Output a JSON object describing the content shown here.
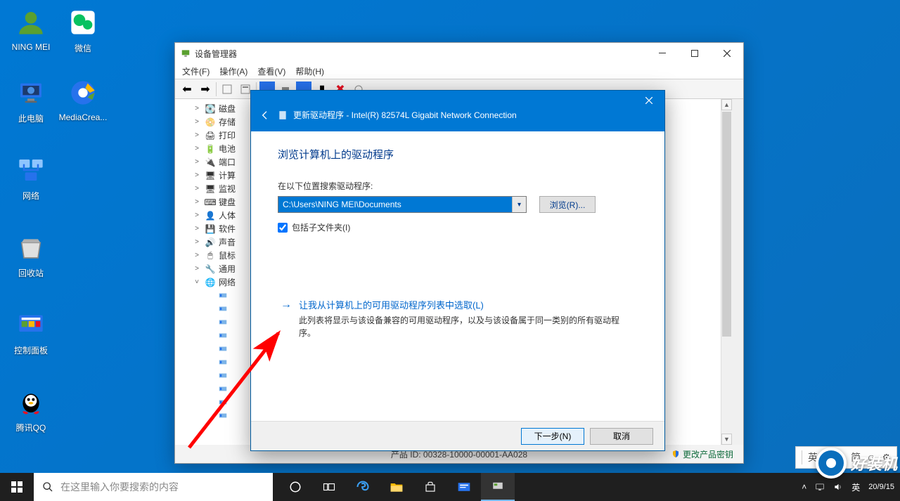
{
  "desktop": {
    "icons": [
      {
        "label": "NING MEI",
        "color": "#5aa030"
      },
      {
        "label": "微信",
        "color": "#07c160"
      },
      {
        "label": "此电脑",
        "color": "#2672ec"
      },
      {
        "label": "MediaCrea...",
        "color": "#2672ec"
      },
      {
        "label": "网络",
        "color": "#2672ec"
      },
      {
        "label": "回收站",
        "color": "#d0d0d0"
      },
      {
        "label": "控制面板",
        "color": "#2672ec"
      },
      {
        "label": "腾讯QQ",
        "color": "#12b7f5"
      }
    ]
  },
  "devmgr": {
    "title": "设备管理器",
    "menu": [
      "文件(F)",
      "操作(A)",
      "查看(V)",
      "帮助(H)"
    ],
    "nodes": [
      {
        "label": "磁盘",
        "icon": "💽"
      },
      {
        "label": "存储",
        "icon": "📀"
      },
      {
        "label": "打印",
        "icon": "🖨"
      },
      {
        "label": "电池",
        "icon": "🔋"
      },
      {
        "label": "端口",
        "icon": "🔌"
      },
      {
        "label": "计算",
        "icon": "🖥"
      },
      {
        "label": "监视",
        "icon": "🖥"
      },
      {
        "label": "键盘",
        "icon": "⌨"
      },
      {
        "label": "人体",
        "icon": "👤"
      },
      {
        "label": "软件",
        "icon": "💾"
      },
      {
        "label": "声音",
        "icon": "🔊"
      },
      {
        "label": "鼠标",
        "icon": "🖱"
      },
      {
        "label": "通用",
        "icon": "🔧"
      },
      {
        "label": "网络",
        "icon": "🌐",
        "expanded": true
      }
    ],
    "footer": "产品 ID: 00328-10000-00001-AA028",
    "footer_link": "更改产品密钥"
  },
  "wizard": {
    "title": "更新驱动程序 - Intel(R) 82574L Gigabit Network Connection",
    "heading": "浏览计算机上的驱动程序",
    "search_label": "在以下位置搜索驱动程序:",
    "path": "C:\\Users\\NING MEI\\Documents",
    "browse_btn": "浏览(R)...",
    "include_sub": "包括子文件夹(I)",
    "link_text": "让我从计算机上的可用驱动程序列表中选取(L)",
    "link_desc": "此列表将显示与该设备兼容的可用驱动程序，以及与该设备属于同一类别的所有驱动程序。",
    "next_btn": "下一步(N)",
    "cancel_btn": "取消"
  },
  "ime": {
    "lang1": "英",
    "lang2": "简"
  },
  "taskbar": {
    "search_placeholder": "在这里输入你要搜索的内容"
  },
  "tray": {
    "date": "20/9/15"
  },
  "brand": {
    "text": "好装机"
  }
}
